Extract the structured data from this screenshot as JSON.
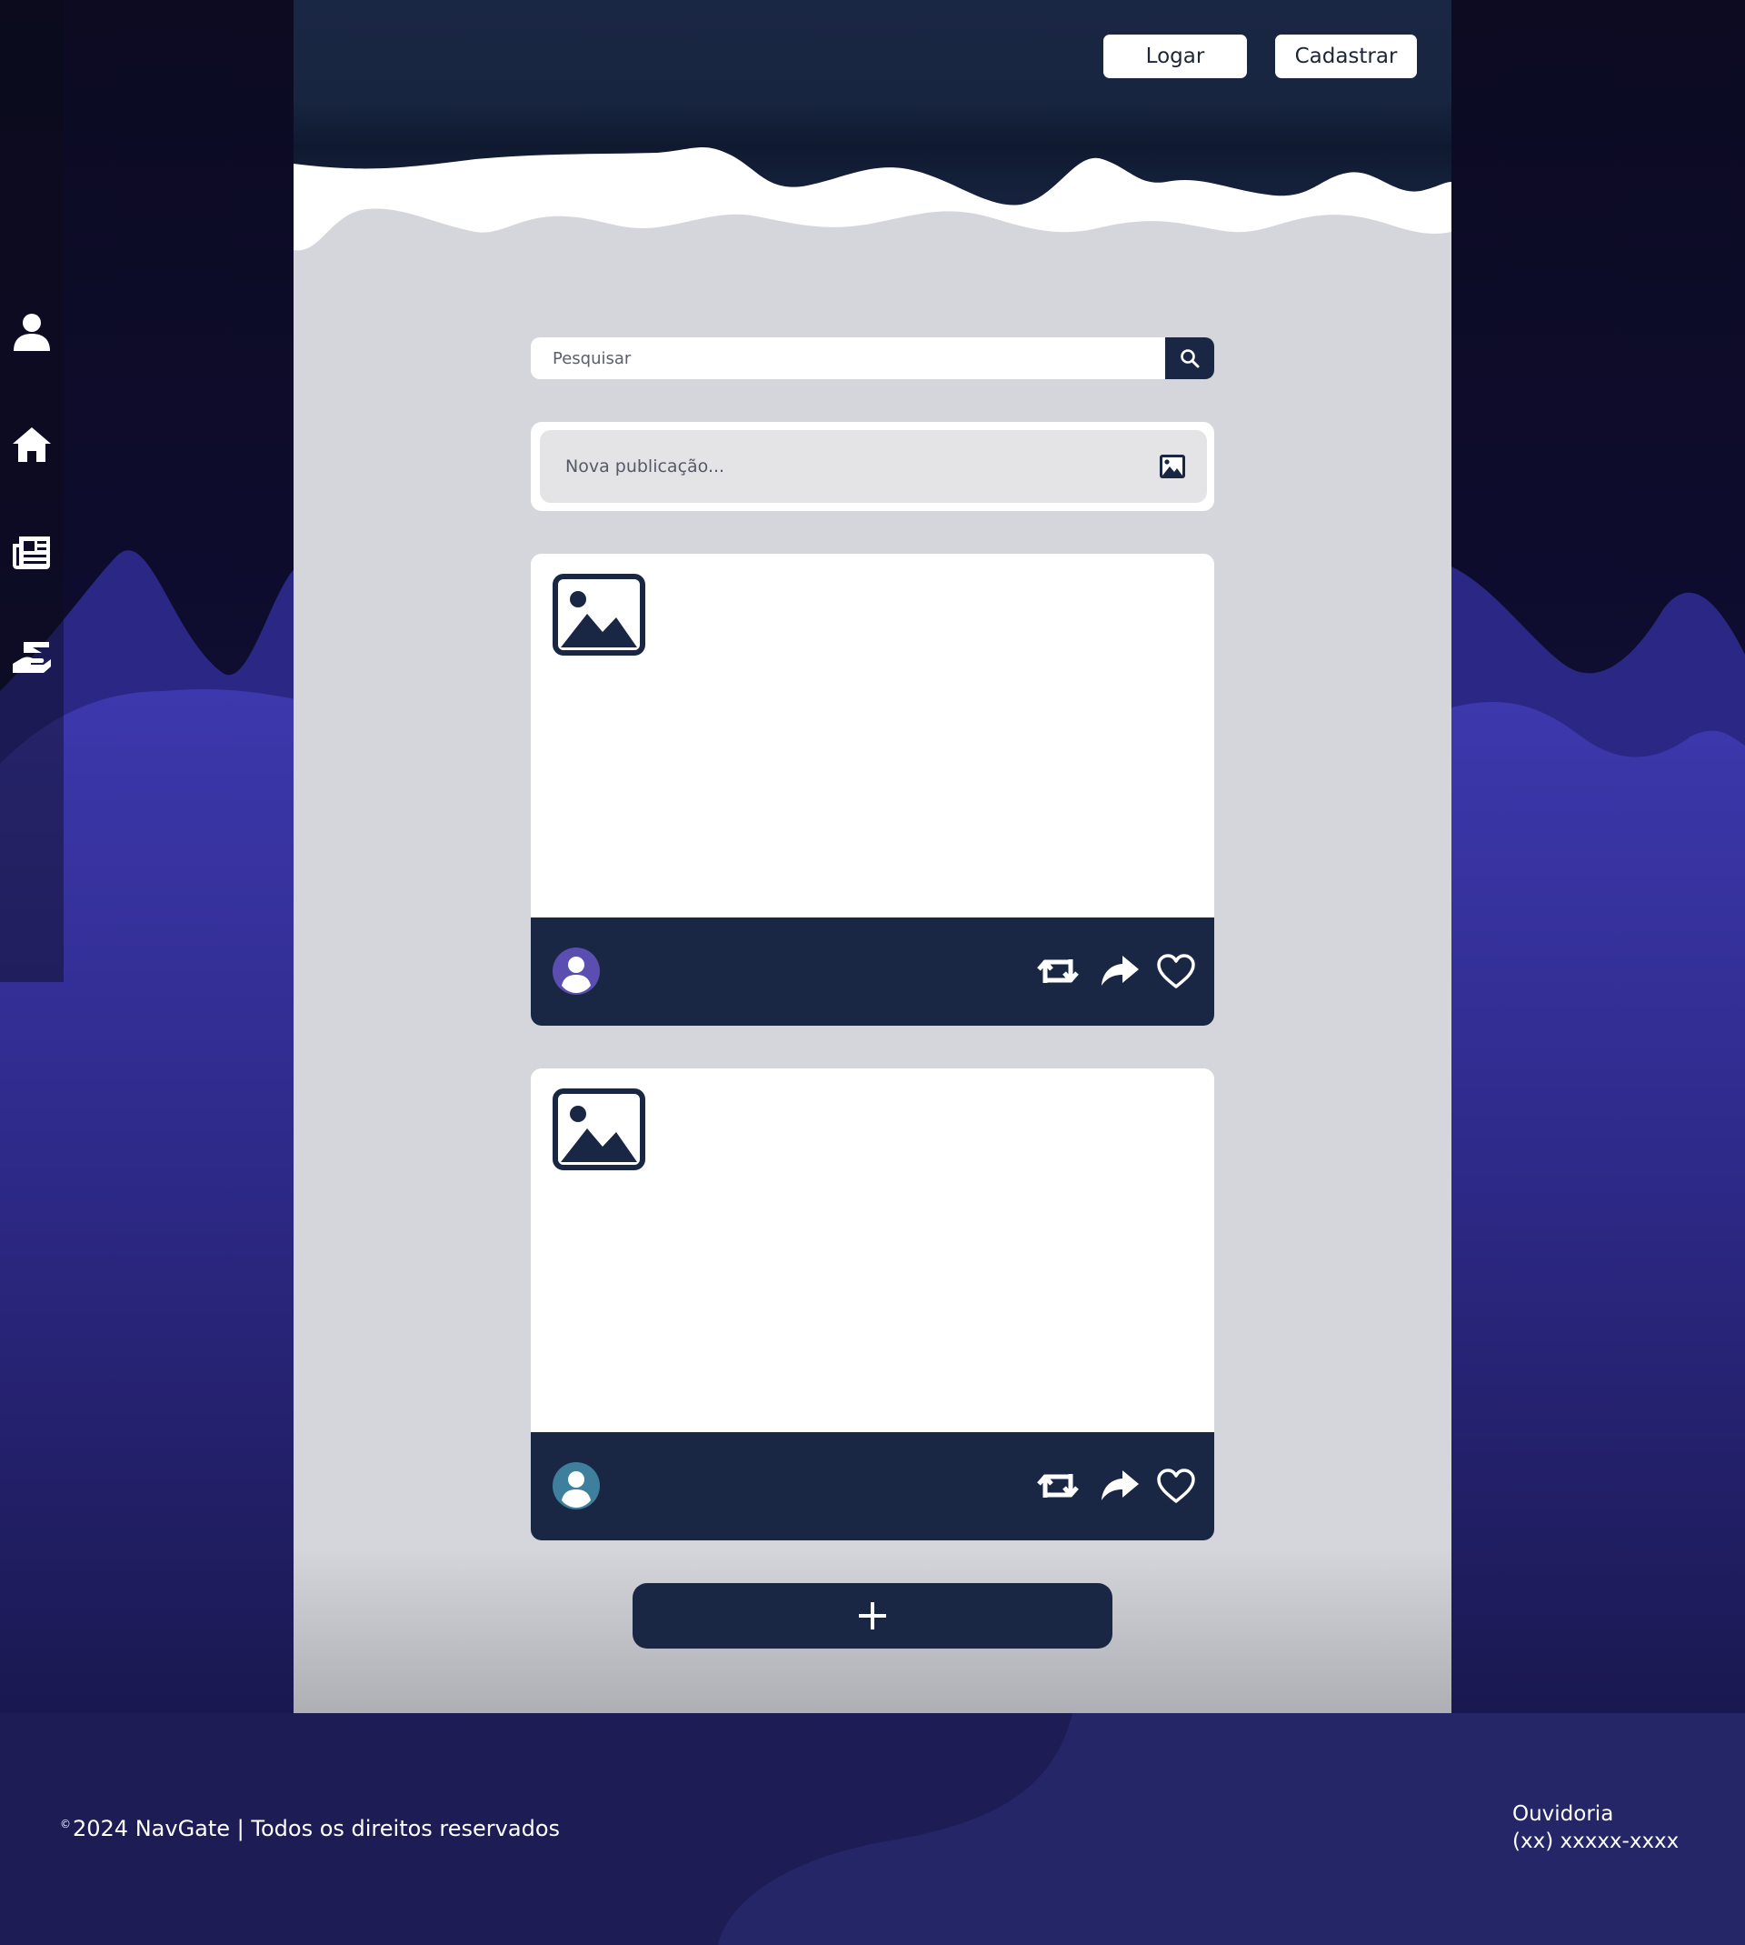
{
  "colors": {
    "navy": "#1a2744",
    "panel_bg": "#d5d6db",
    "indigo_wave": "#3c37aa",
    "deep_bg": "#0e0c2a",
    "footer_bg": "#1e1c55"
  },
  "sidebar": {
    "items": [
      {
        "name": "profile",
        "icon": "user-icon"
      },
      {
        "name": "home",
        "icon": "home-icon"
      },
      {
        "name": "news",
        "icon": "newspaper-icon"
      },
      {
        "name": "donations",
        "icon": "hand-holding-icon"
      }
    ]
  },
  "header": {
    "login_label": "Logar",
    "signup_label": "Cadastrar"
  },
  "search": {
    "placeholder": "Pesquisar",
    "button_icon": "search-icon"
  },
  "composer": {
    "placeholder": "Nova publicação...",
    "attach_icon": "image-icon"
  },
  "posts": [
    {
      "image_icon": "image-placeholder-icon",
      "avatar_color": "#5a4fb0",
      "actions": [
        "retweet-icon",
        "share-icon",
        "heart-icon"
      ]
    },
    {
      "image_icon": "image-placeholder-icon",
      "avatar_color": "#3f7f9e",
      "actions": [
        "retweet-icon",
        "share-icon",
        "heart-icon"
      ]
    }
  ],
  "add_button": {
    "icon": "plus-icon"
  },
  "footer": {
    "copyright_symbol": "©",
    "copyright_text": "2024 NavGate | Todos os direitos reservados",
    "ouvidoria_label": "Ouvidoria",
    "ouvidoria_phone": "(xx) xxxxx-xxxx"
  }
}
